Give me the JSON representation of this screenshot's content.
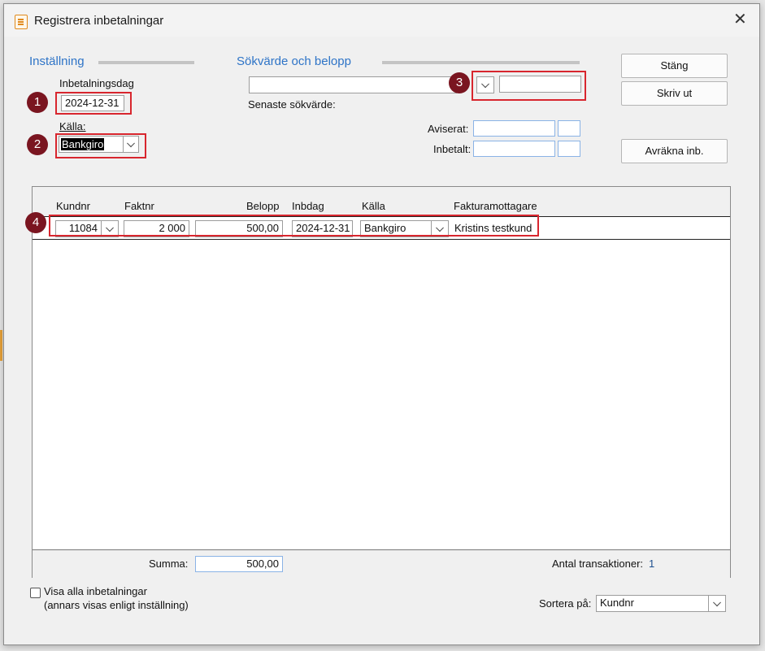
{
  "window": {
    "title": "Registrera inbetalningar",
    "close_glyph": "✕"
  },
  "settings": {
    "section_title": "Inställning",
    "payment_date_label": "Inbetalningsdag",
    "payment_date": "2024-12-31",
    "source_label": "Källa:",
    "source_value": "Bankgiro"
  },
  "search": {
    "section_title": "Sökvärde och belopp",
    "search_value": "",
    "amount_value": "",
    "last_search_label": "Senaste sökvärde:",
    "aviserat_label": "Aviserat:",
    "inbetalt_label": "Inbetalt:"
  },
  "buttons": {
    "close": "Stäng",
    "print": "Skriv ut",
    "settle": "Avräkna inb."
  },
  "table": {
    "columns": [
      "Kundnr",
      "Faktnr",
      "Belopp",
      "Inbdag",
      "Källa",
      "Fakturamottagare"
    ],
    "rows": [
      {
        "kundnr": "11084",
        "faktnr": "2 000",
        "belopp": "500,00",
        "inbdag": "2024-12-31",
        "kalla": "Bankgiro",
        "mottagare": "Kristins testkund"
      }
    ],
    "summa_label": "Summa:",
    "summa_value": "500,00",
    "count_label": "Antal transaktioner:",
    "count_value": "1"
  },
  "footer": {
    "show_all_label": "Visa alla inbetalningar",
    "show_all_note": "(annars visas enligt inställning)",
    "show_all_checked": false,
    "sort_label": "Sortera på:",
    "sort_value": "Kundnr"
  },
  "callouts": [
    "1",
    "2",
    "3",
    "4"
  ],
  "colors": {
    "accent_blue": "#2e74c7",
    "callout_fill": "#7a1520",
    "highlight_red": "#d8262e"
  }
}
